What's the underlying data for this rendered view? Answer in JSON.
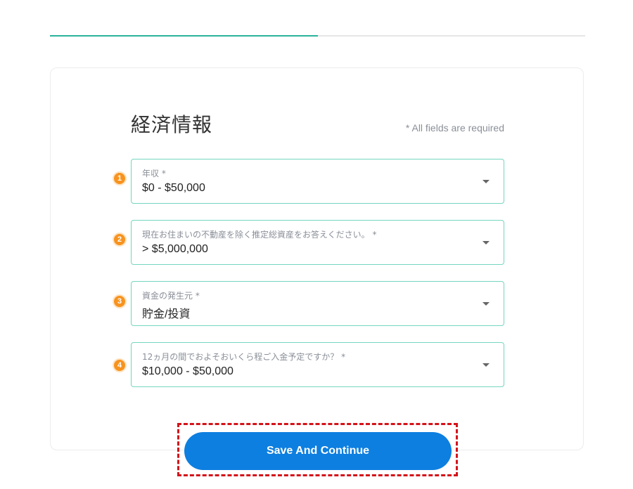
{
  "progress": {
    "fraction": 0.5,
    "fill_color": "#2ab39a",
    "track_color": "#e6e6e6"
  },
  "form": {
    "title": "経済情報",
    "required_note": "* All fields are required",
    "fields": [
      {
        "step": "1",
        "label": "年収 *",
        "value": "$0 - $50,000"
      },
      {
        "step": "2",
        "label": "現在お住まいの不動産を除く推定総資産をお答えください。 *",
        "value": "> $5,000,000"
      },
      {
        "step": "3",
        "label": "資金の発生元 *",
        "value": "貯金/投資"
      },
      {
        "step": "4",
        "label": "12ヵ月の間でおよそおいくら程ご入金予定ですか？ *",
        "value": "$10,000 - $50,000"
      }
    ]
  },
  "actions": {
    "save_label": "Save And Continue"
  },
  "colors": {
    "accent": "#0d7fe0",
    "field_border": "#74d6c0",
    "step_badge": "#f7931e",
    "highlight": "#d3131a"
  }
}
